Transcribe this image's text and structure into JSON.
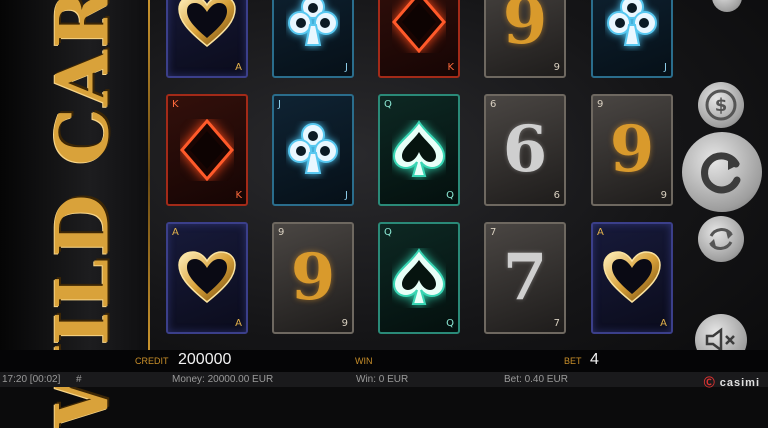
{
  "logo": {
    "text": "WILD CARD"
  },
  "reels": [
    [
      {
        "type": "heart",
        "index": "A"
      },
      {
        "type": "diamond",
        "index": "K"
      },
      {
        "type": "heart",
        "index": "A"
      }
    ],
    [
      {
        "type": "club",
        "index": "J"
      },
      {
        "type": "club",
        "index": "J"
      },
      {
        "type": "number",
        "index": "9",
        "tone": "gold"
      }
    ],
    [
      {
        "type": "diamond",
        "index": "K"
      },
      {
        "type": "spade",
        "index": "Q"
      },
      {
        "type": "spade",
        "index": "Q"
      }
    ],
    [
      {
        "type": "number",
        "index": "9",
        "tone": "gold"
      },
      {
        "type": "number",
        "index": "6",
        "tone": "silver"
      },
      {
        "type": "number",
        "index": "7",
        "tone": "silver"
      }
    ],
    [
      {
        "type": "club",
        "index": "J"
      },
      {
        "type": "number",
        "index": "9",
        "tone": "gold"
      },
      {
        "type": "heart",
        "index": "A"
      }
    ]
  ],
  "controls": {
    "menu_icon": "menu-icon",
    "currency_icon": "dollar-icon",
    "spin_icon": "refresh-icon",
    "autoplay_icon": "autoplay-icon",
    "mute_icon": "mute-icon"
  },
  "info_bar": {
    "credit_label": "CREDIT",
    "credit_value": "200000",
    "win_label": "WIN",
    "bet_label": "BET",
    "bet_value": "4"
  },
  "status_bar": {
    "time": "17:20 [00:02]",
    "hash": "#",
    "money": "Money: 20000.00 EUR",
    "win": "Win: 0 EUR",
    "bet": "Bet: 0.40 EUR",
    "brand": "casimi"
  },
  "colors": {
    "gold": "#d99a2c",
    "accent": "#c98f2a"
  }
}
